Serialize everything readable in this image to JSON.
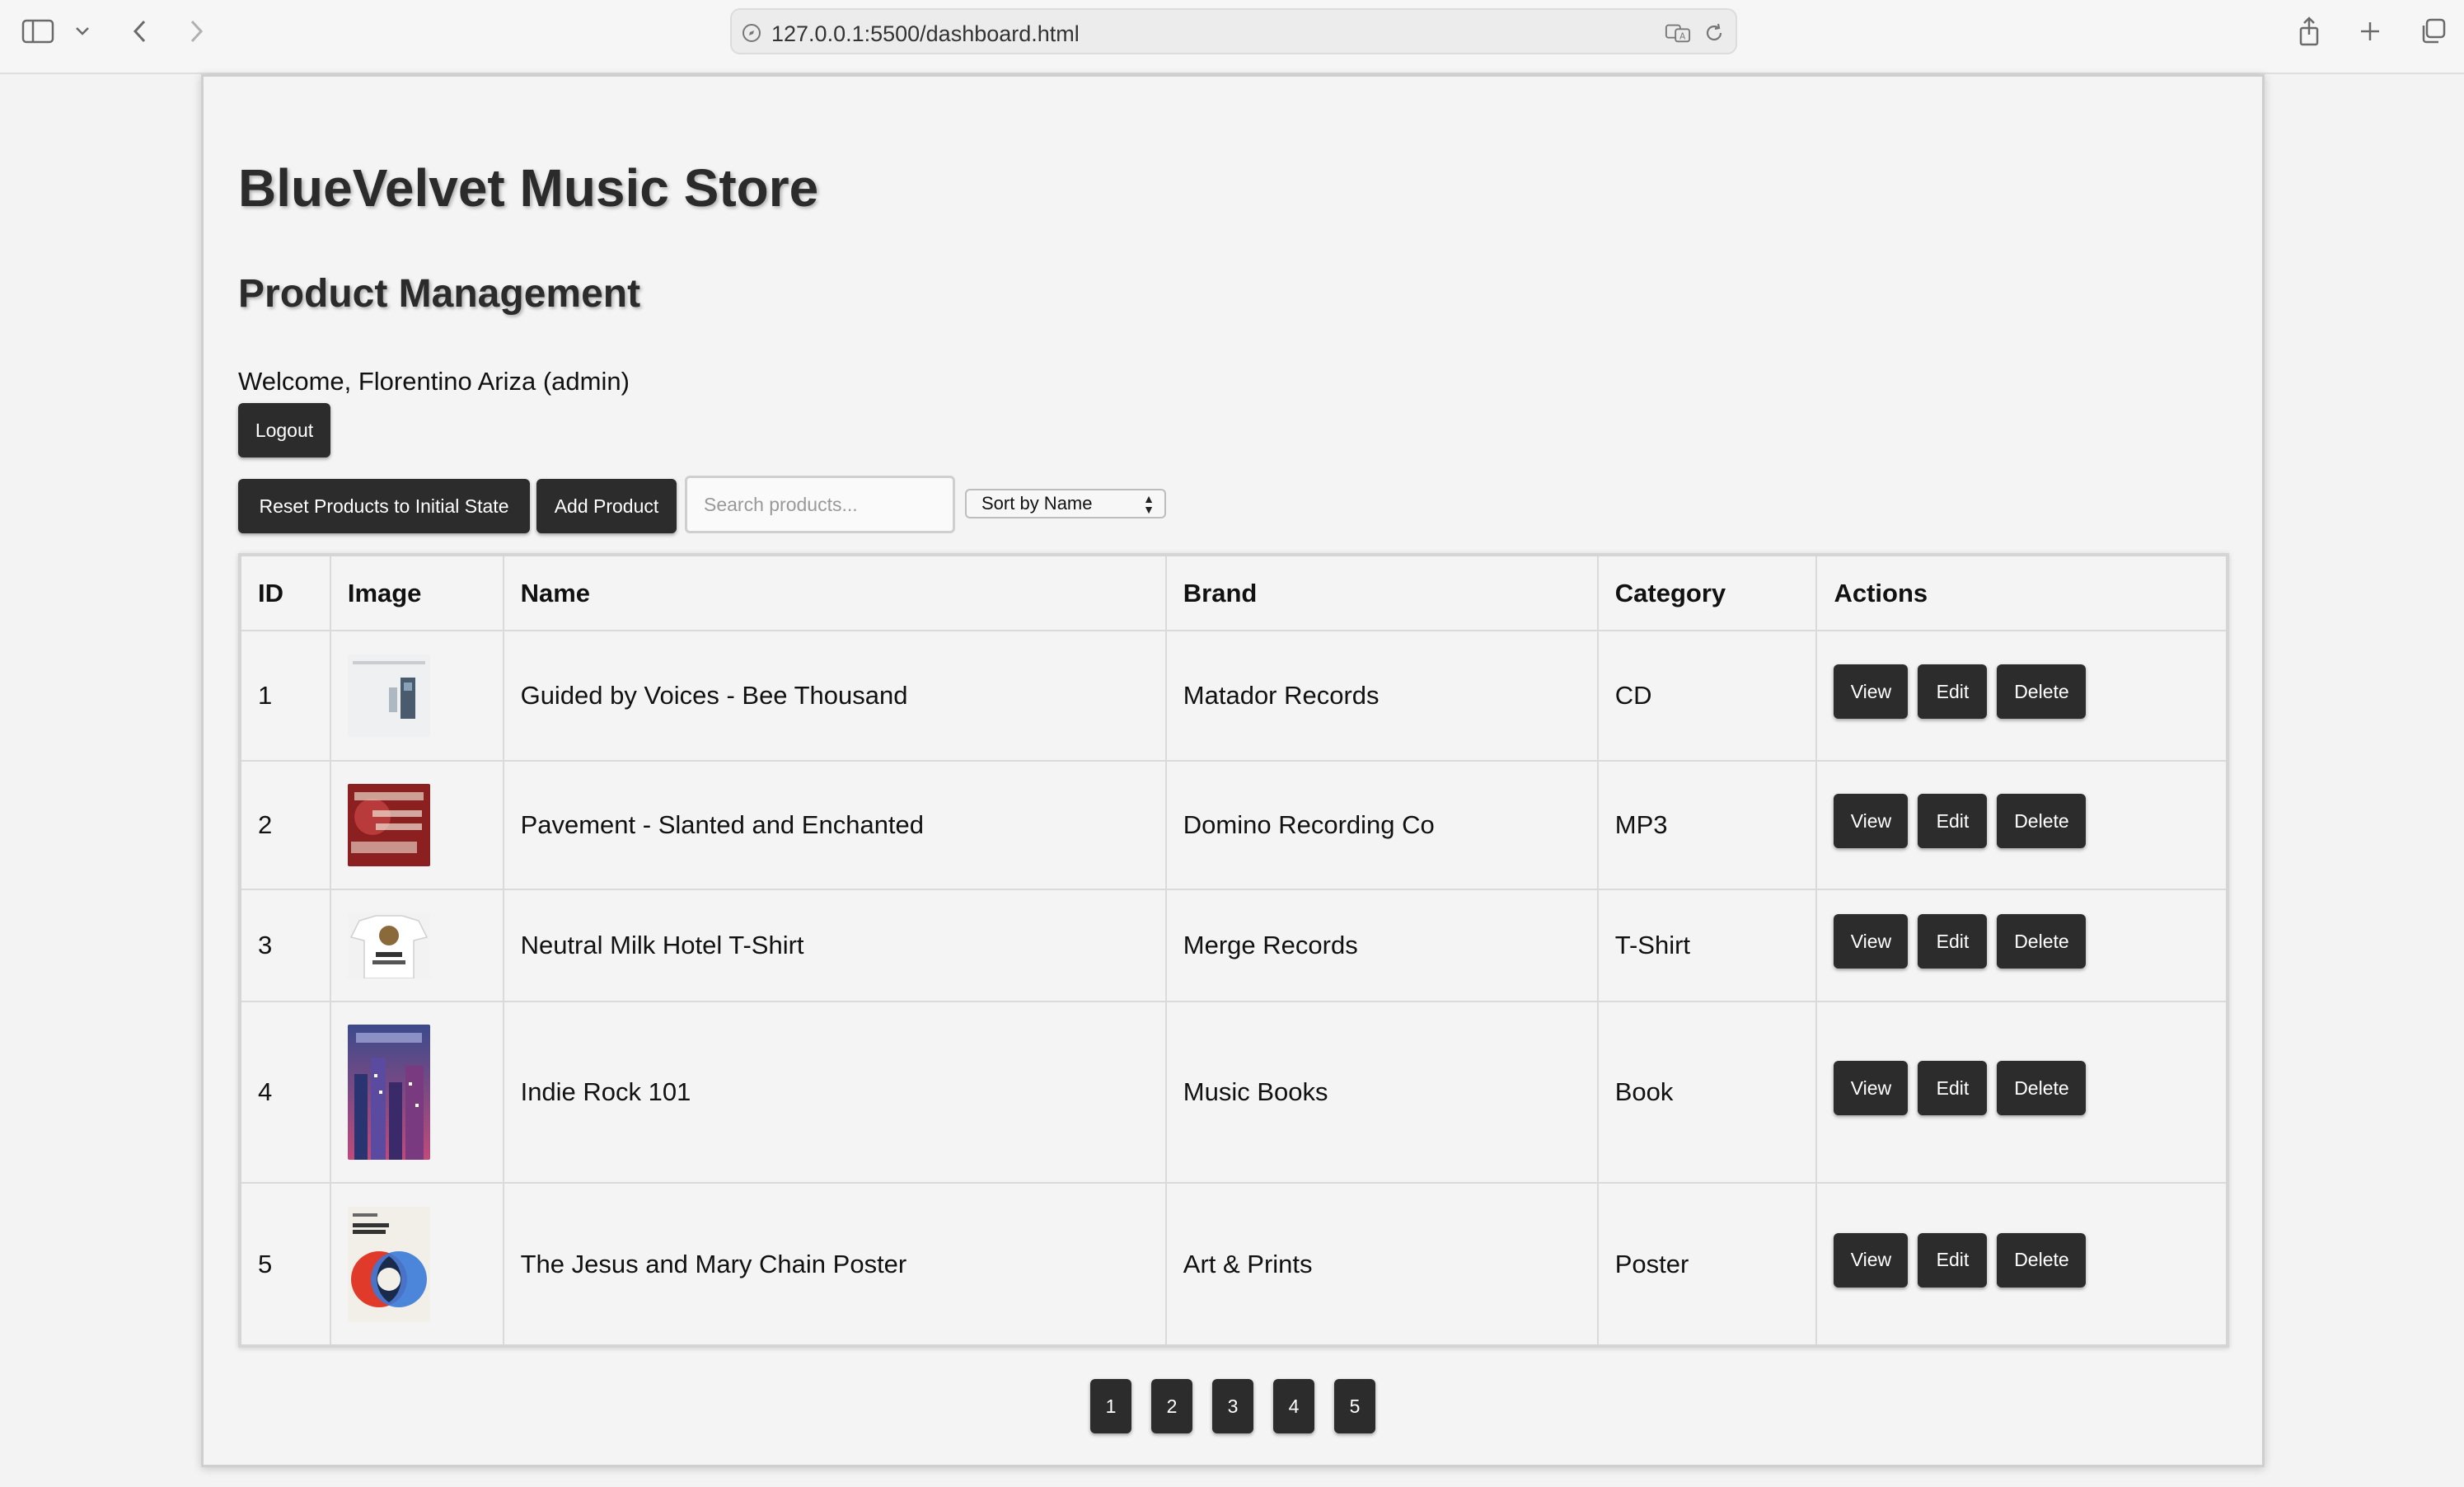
{
  "browser": {
    "url": "127.0.0.1:5500/dashboard.html",
    "icons": [
      "sidebar-icon",
      "chevron-down-icon",
      "back-icon",
      "forward-icon",
      "compass-icon",
      "translate-icon",
      "reload-icon",
      "share-icon",
      "new-tab-icon",
      "tabs-overview-icon"
    ]
  },
  "page": {
    "store_title": "BlueVelvet Music Store",
    "section_title": "Product Management",
    "welcome": "Welcome, Florentino Ariza (admin)",
    "logout_label": "Logout"
  },
  "toolbar": {
    "reset_label": "Reset Products to Initial State",
    "add_label": "Add Product",
    "search_placeholder": "Search products...",
    "sort_value": "Sort by Name"
  },
  "table": {
    "headers": [
      "ID",
      "Image",
      "Name",
      "Brand",
      "Category",
      "Actions"
    ],
    "rows": [
      {
        "id": "1",
        "name": "Guided by Voices - Bee Thousand",
        "brand": "Matador Records",
        "category": "CD"
      },
      {
        "id": "2",
        "name": "Pavement - Slanted and Enchanted",
        "brand": "Domino Recording Co",
        "category": "MP3"
      },
      {
        "id": "3",
        "name": "Neutral Milk Hotel T-Shirt",
        "brand": "Merge Records",
        "category": "T-Shirt"
      },
      {
        "id": "4",
        "name": "Indie Rock 101",
        "brand": "Music Books",
        "category": "Book"
      },
      {
        "id": "5",
        "name": "The Jesus and Mary Chain Poster",
        "brand": "Art & Prints",
        "category": "Poster"
      }
    ],
    "action_labels": {
      "view": "View",
      "edit": "Edit",
      "delete": "Delete"
    }
  },
  "pagination": [
    "1",
    "2",
    "3",
    "4",
    "5"
  ],
  "colors": {
    "button_bg": "#2c2c2c",
    "button_text": "#ffffff",
    "page_bg": "#f4f4f4"
  }
}
